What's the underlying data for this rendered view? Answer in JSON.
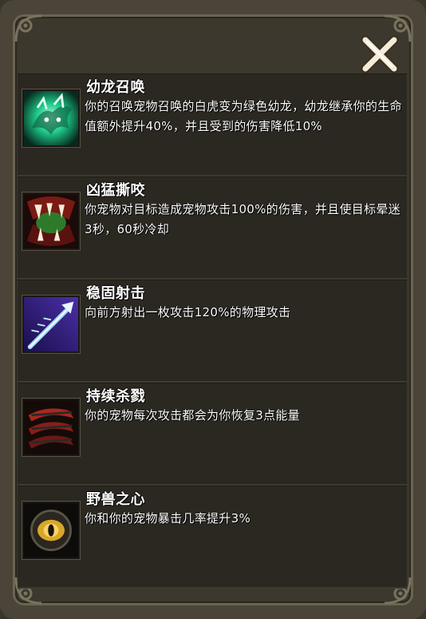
{
  "dialog": {
    "close_icon": "close-x-icon"
  },
  "skills": [
    {
      "name": "幼龙召唤",
      "description": "你的召唤宠物召唤的白虎变为绿色幼龙，幼龙继承你的生命值额外提升40%，并且受到的伤害降低10%",
      "icon": "green-dragon-summon-icon"
    },
    {
      "name": "凶猛撕咬",
      "description": "你宠物对目标造成宠物攻击100%的伤害，并且使目标晕迷3秒，60秒冷却",
      "icon": "fierce-bite-fangs-icon"
    },
    {
      "name": "稳固射击",
      "description": "向前方射出一枚攻击120%的物理攻击",
      "icon": "steady-shot-arrow-icon"
    },
    {
      "name": "持续杀戮",
      "description": "你的宠物每次攻击都会为你恢复3点能量",
      "icon": "sustained-slaughter-claws-icon"
    },
    {
      "name": "野兽之心",
      "description": "你和你的宠物暴击几率提升3%",
      "icon": "beast-heart-eye-icon"
    }
  ]
}
